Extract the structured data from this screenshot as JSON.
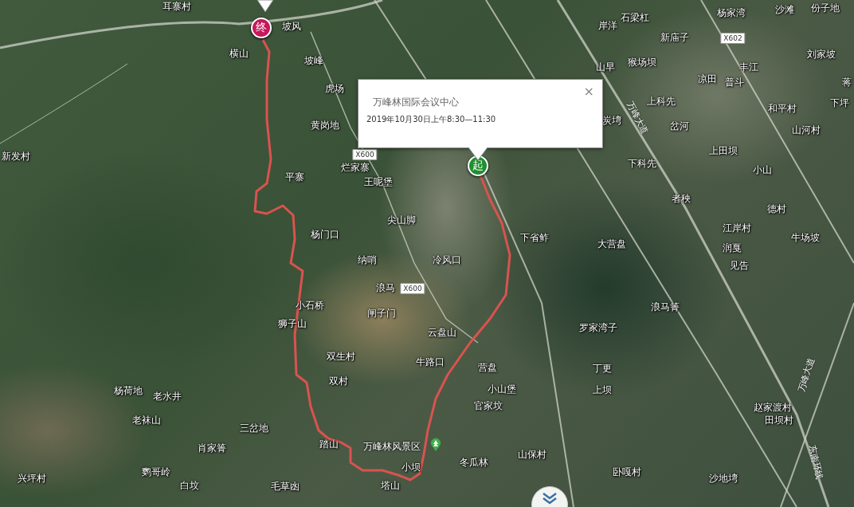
{
  "map": {
    "place_labels": [
      "耳寨村",
      "坡风",
      "横山",
      "坡峰",
      "虎场",
      "黄岗地",
      "新发村",
      "平寨",
      "烂家寨",
      "王呢堡",
      "尖山脚",
      "杨门口",
      "纳哨",
      "冷风口",
      "浪马",
      "小石桥",
      "狮子山",
      "闸子门",
      "云盘山",
      "双生村",
      "牛路口",
      "营盘",
      "杨荷地",
      "老水井",
      "双村",
      "小山堡",
      "官家坟",
      "老袜山",
      "三岔地",
      "肖家箐",
      "踏山",
      "兴坪村",
      "鹦哥岭",
      "小坝",
      "冬瓜林",
      "山保村",
      "白坟",
      "毛草凼",
      "塔山"
    ],
    "place_labels_east": [
      "岸洋",
      "石梁杠",
      "杨家湾",
      "沙滩",
      "份子地",
      "新庙子",
      "山早",
      "猴场坝",
      "丰江",
      "刘家坡",
      "凉田",
      "普斗",
      "蒋",
      "上科先",
      "和平村",
      "下坪",
      "炭塆",
      "岔河",
      "山河村",
      "上田坝",
      "下科先",
      "小山",
      "者秧",
      "德村",
      "下省鲊",
      "大营盘",
      "江岸村",
      "润戛",
      "牛场坡",
      "见告",
      "浪马箐",
      "罗家湾子",
      "丁更",
      "上坝",
      "赵家渡村",
      "田坝村",
      "卧嘎村",
      "沙地塆"
    ],
    "road_badges": [
      "X602",
      "X600",
      "X600"
    ],
    "road_names": [
      "万峰大道",
      "万峰大道",
      "东南环线"
    ],
    "markers": [
      {
        "kind": "end",
        "label": "终"
      },
      {
        "kind": "start",
        "label": "起"
      }
    ],
    "poi": {
      "label": "万峰林风景区"
    }
  },
  "popup": {
    "title": "万峰林国际会议中心",
    "time": "2019年10月30日上午8:30—11:30",
    "close": "×"
  }
}
